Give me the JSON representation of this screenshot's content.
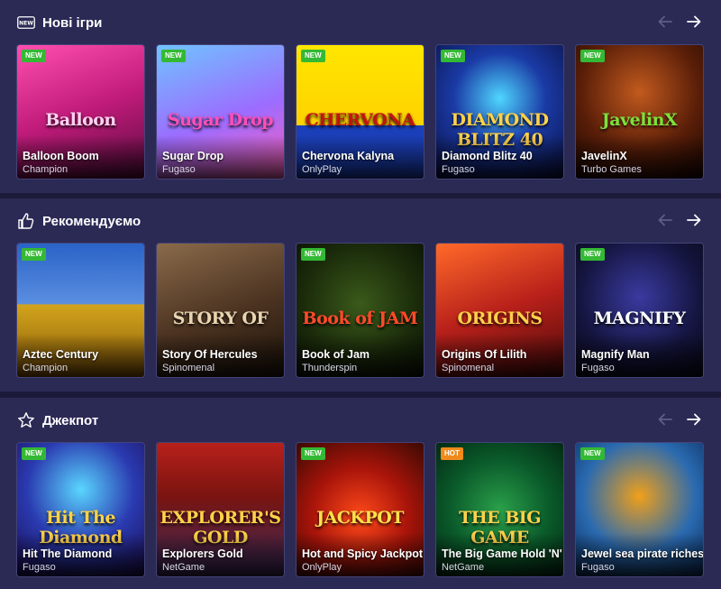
{
  "nav": {
    "prev_symbol": "←",
    "next_symbol": "→"
  },
  "sections": [
    {
      "title": "Нові ігри",
      "icon": "new-badge-icon",
      "icon_text": "NEW",
      "games": [
        {
          "name": "Balloon Boom",
          "provider": "Champion",
          "badge": "NEW",
          "art_text": "Balloon",
          "bg": "linear-gradient(160deg,#ff4fb0 0%,#c01b7a 50%,#5a0b3e 100%)",
          "art_color": "#ffd1f0"
        },
        {
          "name": "Sugar Drop",
          "provider": "Fugaso",
          "badge": "NEW",
          "art_text": "Sugar Drop",
          "bg": "linear-gradient(160deg,#6fc4ff 0%,#9c6cff 55%,#ff5fb7 100%)",
          "art_color": "#ff4fb8"
        },
        {
          "name": "Chervona Kalyna",
          "provider": "OnlyPlay",
          "badge": "NEW",
          "art_text": "CHERVONA",
          "bg": "linear-gradient(180deg,#ffe600 0%,#ffd200 60%,#1b3fb8 60%,#1b3fb8 100%)",
          "art_color": "#c2150f"
        },
        {
          "name": "Diamond Blitz 40",
          "provider": "Fugaso",
          "badge": "NEW",
          "art_text": "DIAMOND BLITZ 40",
          "bg": "radial-gradient(circle at 50% 40%,#4fd6ff 0%,#1a3aa5 45%,#0a0e3e 100%)",
          "art_color": "#ffd24a"
        },
        {
          "name": "JavelinX",
          "provider": "Turbo Games",
          "badge": "NEW",
          "art_text": "JavelinX",
          "bg": "radial-gradient(circle at 50% 35%,#c25a1e 0%,#5a1e08 55%,#1a0602 100%)",
          "art_color": "#7ee03c"
        }
      ]
    },
    {
      "title": "Рекомендуємо",
      "icon": "thumbs-up-icon",
      "icon_text": "",
      "games": [
        {
          "name": "Aztec Century",
          "provider": "Champion",
          "badge": "NEW",
          "art_text": "",
          "bg": "linear-gradient(180deg,#2a63c7 0%,#5a8ee0 45%,#d2a41c 46%,#8a5a08 100%)",
          "art_color": "#ffd24a"
        },
        {
          "name": "Story Of Hercules",
          "provider": "Spinomenal",
          "badge": "",
          "art_text": "STORY OF",
          "bg": "linear-gradient(160deg,#8a6a4a 0%,#4a3220 55%,#1e130a 100%)",
          "art_color": "#e8d4b0"
        },
        {
          "name": "Book of Jam",
          "provider": "Thunderspin",
          "badge": "NEW",
          "art_text": "Book of JAM",
          "bg": "radial-gradient(circle at 50% 45%,#3a5a1a 0%,#1a2a0a 60%,#0a1204 100%)",
          "art_color": "#ff4a2a"
        },
        {
          "name": "Origins Of Lilith",
          "provider": "Spinomenal",
          "badge": "",
          "art_text": "ORIGINS",
          "bg": "linear-gradient(160deg,#ff6a2a 0%,#b8201a 50%,#4a0a0a 100%)",
          "art_color": "#ffcf4a"
        },
        {
          "name": "Magnify Man",
          "provider": "Fugaso",
          "badge": "NEW",
          "art_text": "MAGNIFY",
          "bg": "radial-gradient(circle at 50% 40%,#3a3aa0 0%,#14143e 60%,#080818 100%)",
          "art_color": "#ffffff"
        }
      ]
    },
    {
      "title": "Джекпот",
      "icon": "star-icon",
      "icon_text": "",
      "games": [
        {
          "name": "Hit The Diamond",
          "provider": "Fugaso",
          "badge": "NEW",
          "art_text": "Hit The Diamond",
          "bg": "radial-gradient(circle at 50% 35%,#5ad6ff 0%,#2a3ab0 50%,#1a0a4e 100%)",
          "art_color": "#ffd24a"
        },
        {
          "name": "Explorers Gold",
          "provider": "NetGame",
          "badge": "",
          "art_text": "EXPLORER'S GOLD",
          "bg": "linear-gradient(180deg,#b8201a 0%,#7a1410 40%,#3a2a5a 100%)",
          "art_color": "#ffd24a"
        },
        {
          "name": "Hot and Spicy Jackpot",
          "provider": "OnlyPlay",
          "badge": "NEW",
          "art_text": "JACKPOT",
          "bg": "radial-gradient(circle at 50% 55%,#ff4a1a 0%,#a8140a 50%,#3a0a04 100%)",
          "art_color": "#ffe04a"
        },
        {
          "name": "The Big Game Hold 'N' Link",
          "provider": "NetGame",
          "badge": "HOT",
          "art_text": "THE BIG GAME",
          "bg": "radial-gradient(circle at 50% 50%,#2aa04a 0%,#0a5a2a 55%,#042a14 100%)",
          "art_color": "#ffd24a"
        },
        {
          "name": "Jewel sea pirate riches",
          "provider": "Fugaso",
          "badge": "NEW",
          "art_text": "",
          "bg": "radial-gradient(circle at 50% 40%,#f0a01a 0%,#2a6ab0 55%,#0a2a5a 100%)",
          "art_color": "#ffd24a"
        }
      ]
    }
  ]
}
